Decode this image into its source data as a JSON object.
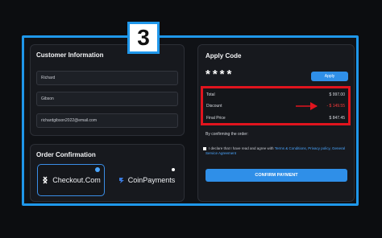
{
  "step_badge": "3",
  "customer": {
    "title": "Customer Information",
    "first_name": "Richard",
    "last_name": "Gibson",
    "email": "richardgibson2022@email.com"
  },
  "order": {
    "title": "Order Confirmation",
    "methods": [
      {
        "label": "Checkout.Com",
        "icon": "checkout-icon",
        "selected": true
      },
      {
        "label": "CoinPayments",
        "icon": "coinpayments-icon",
        "selected": false
      }
    ]
  },
  "apply": {
    "title": "Apply Code",
    "code_mask": "****",
    "apply_label": "Apply"
  },
  "summary": {
    "total_label": "Total",
    "total_value": "$ 997.00",
    "discount_label": "Discount",
    "discount_value": "- $ 149.55",
    "final_label": "Final Price",
    "final_value": "$ 847.45"
  },
  "confirm": {
    "intro": "By confirming the order:",
    "declaration_prefix": "I declare that I have read and agree with",
    "terms_link": "Terms & Conditions",
    "mid_text": ", Privacy policy",
    "service_link": ", General Service Agreement",
    "button_label": "CONFIRM PAYMENT"
  },
  "colors": {
    "accent": "#2f8fe8",
    "highlight": "#e0141e",
    "frame": "#1f97ea"
  }
}
